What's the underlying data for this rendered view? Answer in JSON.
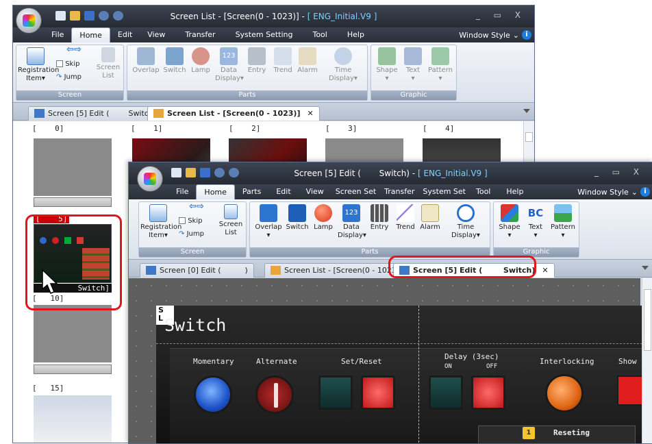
{
  "window1": {
    "title": "Screen List - [Screen(0 - 1023)]",
    "project": "[ ENG_Initial.V9 ]",
    "menu": [
      "File",
      "Home",
      "Edit",
      "View",
      "Transfer",
      "System Setting",
      "Tool",
      "Help"
    ],
    "window_style": "Window Style",
    "ribbon": {
      "screen_group": "Screen",
      "registration": "Registration",
      "item": "Item",
      "skip": "Skip",
      "jump": "Jump",
      "screen_list": "Screen",
      "screen_list2": "List",
      "parts_group": "Parts",
      "parts": [
        "Overlap",
        "Switch",
        "Lamp",
        "Data",
        "Entry",
        "Trend",
        "Alarm",
        "Time"
      ],
      "parts2": {
        "data": "Display",
        "time": "Display"
      },
      "graphic_group": "Graphic",
      "graphic": [
        "Shape",
        "Text",
        "Pattern"
      ]
    },
    "tabs": [
      "Screen [5] Edit (        Switch)",
      "Screen List - [Screen(0 - 1023)]"
    ],
    "thumb_labels": [
      "[    0]",
      "[    1]",
      "[    2]",
      "[    3]",
      "[    4]",
      "[    5]",
      "[   10]",
      "[   15]"
    ],
    "thumb_name_5": "Switch]"
  },
  "window2": {
    "title": "Screen [5] Edit (       Switch)",
    "project": "[ ENG_Initial.V9 ]",
    "menu": [
      "File",
      "Home",
      "Parts",
      "Edit",
      "View",
      "Screen Set",
      "Transfer",
      "System Set",
      "Tool",
      "Help"
    ],
    "window_style": "Window Style",
    "tabs": [
      "Screen [0] Edit (          )",
      "Screen List - [Screen(0 - 1023)]",
      "Screen [5] Edit (        Switch)"
    ],
    "screen": {
      "heading": "Switch",
      "labels": [
        "Momentary",
        "Alternate",
        "Set/Reset",
        "Delay (3sec)",
        "Interlocking",
        "Show"
      ],
      "on": "ON",
      "off": "OFF",
      "resetting": "Reseting"
    }
  },
  "colors": {
    "highlight": "#e0151d",
    "titlebar": "#2b303a",
    "ribbon": "#e4e9f0"
  }
}
